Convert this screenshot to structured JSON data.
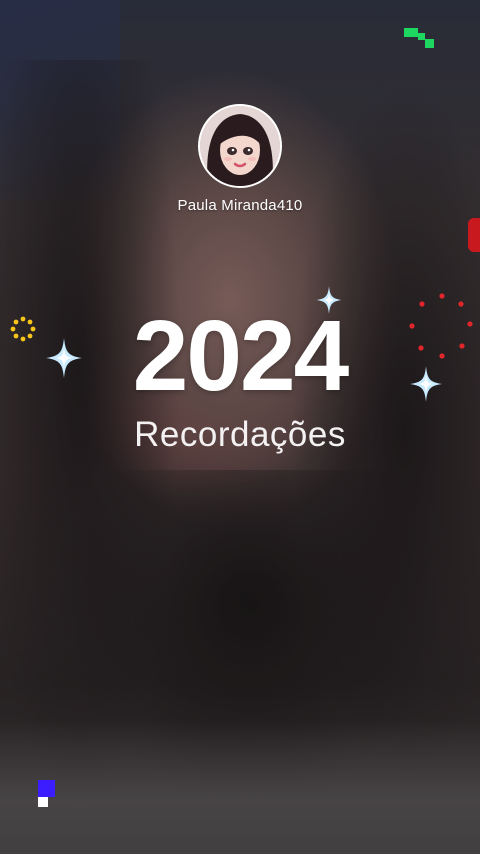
{
  "profile": {
    "username": "Paula Miranda410",
    "avatar_icon": "avatar-illustration"
  },
  "title": {
    "year": "2024",
    "subtitle": "Recordações"
  },
  "decorations": {
    "colors": {
      "text": "#ffffff",
      "sparkle": "#bfe6ff",
      "gold_ring": "#f5c518",
      "red_dots": "#e0262b",
      "green_pixels": "#1ed760",
      "blue_pixel": "#3b1dff"
    },
    "icons": [
      "sparkle-icon",
      "dotted-ring-icon",
      "red-dot-circle-icon",
      "pixel-icon"
    ]
  }
}
